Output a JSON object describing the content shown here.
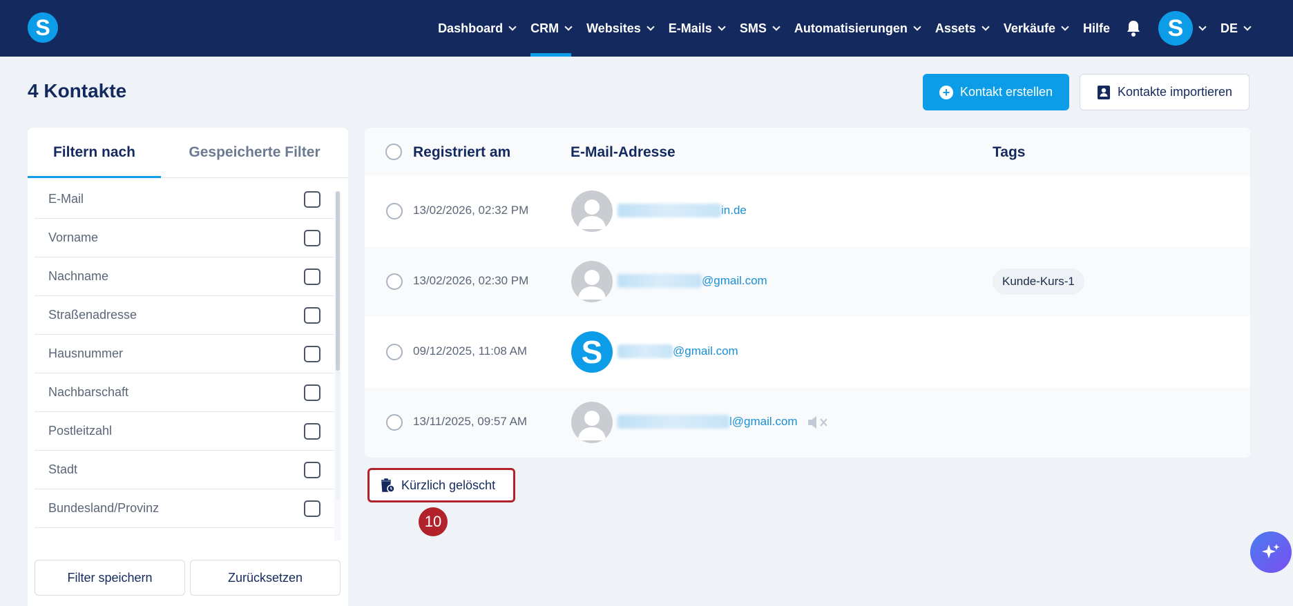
{
  "nav": {
    "logo_letter": "S",
    "items": [
      {
        "label": "Dashboard",
        "dropdown": true
      },
      {
        "label": "CRM",
        "dropdown": true,
        "active": true
      },
      {
        "label": "Websites",
        "dropdown": true
      },
      {
        "label": "E-Mails",
        "dropdown": true
      },
      {
        "label": "SMS",
        "dropdown": true
      },
      {
        "label": "Automatisierungen",
        "dropdown": true
      },
      {
        "label": "Assets",
        "dropdown": true
      },
      {
        "label": "Verkäufe",
        "dropdown": true
      },
      {
        "label": "Hilfe",
        "dropdown": false
      }
    ],
    "avatar_letter": "S",
    "language": "DE"
  },
  "header": {
    "title": "4 Kontakte",
    "create_label": "Kontakt erstellen",
    "import_label": "Kontakte importieren"
  },
  "filters": {
    "tabs": [
      "Filtern nach",
      "Gespeicherte Filter"
    ],
    "fields": [
      "E-Mail",
      "Vorname",
      "Nachname",
      "Straßenadresse",
      "Hausnummer",
      "Nachbarschaft",
      "Postleitzahl",
      "Stadt",
      "Bundesland/Provinz"
    ],
    "save_label": "Filter speichern",
    "reset_label": "Zurücksetzen"
  },
  "table": {
    "columns": [
      "Registriert am",
      "E-Mail-Adresse",
      "Tags"
    ],
    "rows": [
      {
        "date": "13/02/2026, 02:32 PM",
        "email_suffix": "in.de",
        "tag": ""
      },
      {
        "date": "13/02/2026, 02:30 PM",
        "email_suffix": "@gmail.com",
        "tag": "Kunde-Kurs-1"
      },
      {
        "date": "09/12/2025, 11:08 AM",
        "email_suffix": "@gmail.com",
        "tag": ""
      },
      {
        "date": "13/11/2025, 09:57 AM",
        "email_suffix": "l@gmail.com",
        "tag": ""
      }
    ]
  },
  "deleted": {
    "label": "Kürzlich gelöscht"
  },
  "step": {
    "number": "10"
  },
  "colors": {
    "nav_bg": "#14295e",
    "accent": "#0d9de8",
    "highlight": "#b2222a"
  }
}
